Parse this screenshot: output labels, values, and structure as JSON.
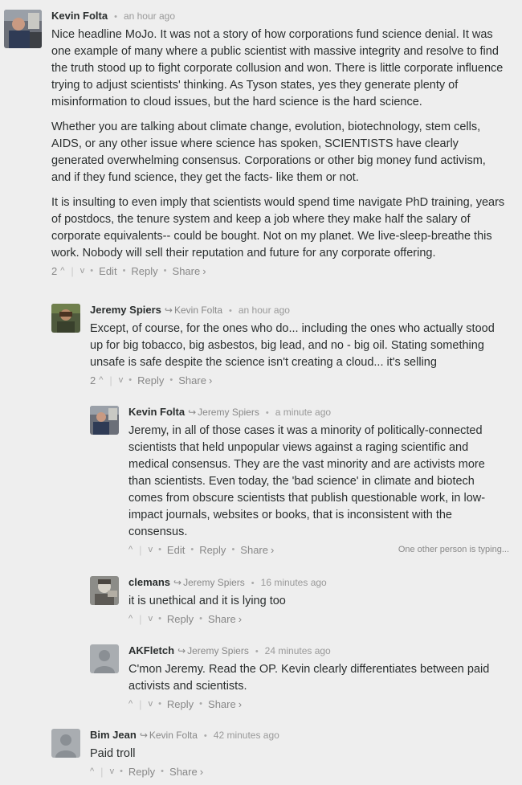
{
  "vote_up_icon": "^",
  "vote_down_icon": "v",
  "reply_arrow_icon": "↪",
  "share_chevron_icon": "›",
  "comments": [
    {
      "author": "Kevin Folta",
      "parent": "",
      "time": "an hour ago",
      "paragraphs": [
        "Nice headline MoJo. It was not a story of how corporations fund science denial. It was one example of many where a public scientist with massive integrity and resolve to find the truth stood up to fight corporate collusion and won. There is little corporate influence trying to adjust scientists' thinking. As Tyson states, yes they generate plenty of misinformation to cloud issues, but the hard science is the hard science.",
        "Whether you are talking about climate change, evolution, biotechnology, stem cells, AIDS, or any other issue where science has spoken, SCIENTISTS have clearly generated overwhelming consensus. Corporations or other big money fund activism, and if they fund science, they get the facts- like them or not.",
        "It is insulting to even imply that scientists would spend time navigate PhD training, years of postdocs, the tenure system and keep a job where they make half the salary of corporate equivalents-- could be bought. Not on my planet. We live-sleep-breathe this work. Nobody will sell their reputation and future for any corporate offering."
      ],
      "votes": "2",
      "edit": "Edit",
      "reply": "Reply",
      "share": "Share"
    },
    {
      "author": "Jeremy Spiers",
      "parent": "Kevin Folta",
      "time": "an hour ago",
      "paragraphs": [
        "Except, of course, for the ones who do... including the ones who actually stood up for big tobacco, big asbestos, big lead, and no - big oil. Stating something unsafe is safe despite the science isn't creating a cloud... it's selling"
      ],
      "votes": "2",
      "reply": "Reply",
      "share": "Share"
    },
    {
      "author": "Kevin Folta",
      "parent": "Jeremy Spiers",
      "time": "a minute ago",
      "paragraphs": [
        "Jeremy, in all of those cases it was a minority of politically-connected scientists that held unpopular views against a raging scientific and medical consensus. They are the vast minority and are activists more than scientists. Even today, the 'bad science' in climate and biotech comes from obscure scientists that publish questionable work, in low-impact journals, websites or books, that is inconsistent with the consensus."
      ],
      "edit": "Edit",
      "reply": "Reply",
      "share": "Share",
      "typing": "One other person is typing..."
    },
    {
      "author": "clemans",
      "parent": "Jeremy Spiers",
      "time": "16 minutes ago",
      "paragraphs": [
        "it is unethical and it is lying too"
      ],
      "reply": "Reply",
      "share": "Share"
    },
    {
      "author": "AKFletch",
      "parent": "Jeremy Spiers",
      "time": "24 minutes ago",
      "paragraphs": [
        "C'mon Jeremy. Read the OP. Kevin clearly differentiates between paid activists and scientists."
      ],
      "reply": "Reply",
      "share": "Share"
    },
    {
      "author": "Bim Jean",
      "parent": "Kevin Folta",
      "time": "42 minutes ago",
      "paragraphs": [
        "Paid troll"
      ],
      "reply": "Reply",
      "share": "Share"
    }
  ]
}
